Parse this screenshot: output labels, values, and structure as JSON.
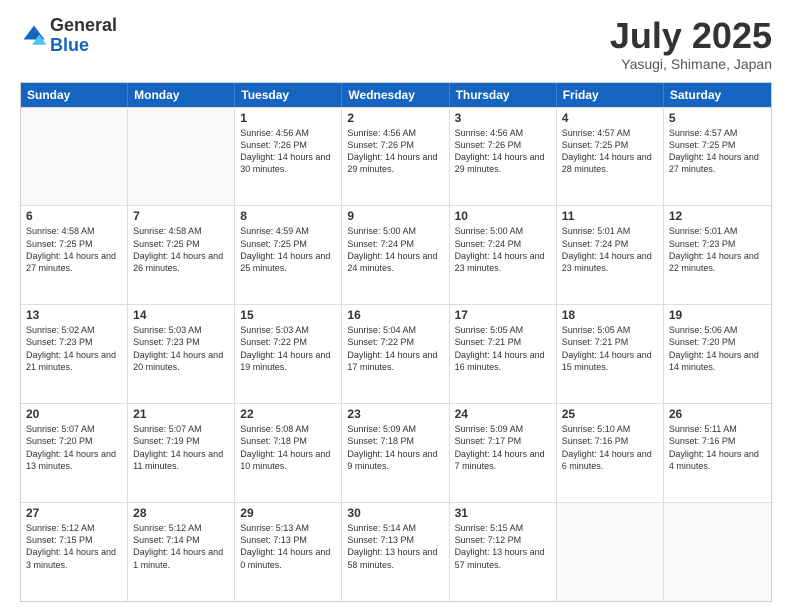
{
  "logo": {
    "general": "General",
    "blue": "Blue"
  },
  "header": {
    "month": "July 2025",
    "location": "Yasugi, Shimane, Japan"
  },
  "weekdays": [
    "Sunday",
    "Monday",
    "Tuesday",
    "Wednesday",
    "Thursday",
    "Friday",
    "Saturday"
  ],
  "rows": [
    [
      {
        "day": "",
        "empty": true
      },
      {
        "day": "",
        "empty": true
      },
      {
        "day": "1",
        "sunrise": "Sunrise: 4:56 AM",
        "sunset": "Sunset: 7:26 PM",
        "daylight": "Daylight: 14 hours and 30 minutes."
      },
      {
        "day": "2",
        "sunrise": "Sunrise: 4:56 AM",
        "sunset": "Sunset: 7:26 PM",
        "daylight": "Daylight: 14 hours and 29 minutes."
      },
      {
        "day": "3",
        "sunrise": "Sunrise: 4:56 AM",
        "sunset": "Sunset: 7:26 PM",
        "daylight": "Daylight: 14 hours and 29 minutes."
      },
      {
        "day": "4",
        "sunrise": "Sunrise: 4:57 AM",
        "sunset": "Sunset: 7:25 PM",
        "daylight": "Daylight: 14 hours and 28 minutes."
      },
      {
        "day": "5",
        "sunrise": "Sunrise: 4:57 AM",
        "sunset": "Sunset: 7:25 PM",
        "daylight": "Daylight: 14 hours and 27 minutes."
      }
    ],
    [
      {
        "day": "6",
        "sunrise": "Sunrise: 4:58 AM",
        "sunset": "Sunset: 7:25 PM",
        "daylight": "Daylight: 14 hours and 27 minutes."
      },
      {
        "day": "7",
        "sunrise": "Sunrise: 4:58 AM",
        "sunset": "Sunset: 7:25 PM",
        "daylight": "Daylight: 14 hours and 26 minutes."
      },
      {
        "day": "8",
        "sunrise": "Sunrise: 4:59 AM",
        "sunset": "Sunset: 7:25 PM",
        "daylight": "Daylight: 14 hours and 25 minutes."
      },
      {
        "day": "9",
        "sunrise": "Sunrise: 5:00 AM",
        "sunset": "Sunset: 7:24 PM",
        "daylight": "Daylight: 14 hours and 24 minutes."
      },
      {
        "day": "10",
        "sunrise": "Sunrise: 5:00 AM",
        "sunset": "Sunset: 7:24 PM",
        "daylight": "Daylight: 14 hours and 23 minutes."
      },
      {
        "day": "11",
        "sunrise": "Sunrise: 5:01 AM",
        "sunset": "Sunset: 7:24 PM",
        "daylight": "Daylight: 14 hours and 23 minutes."
      },
      {
        "day": "12",
        "sunrise": "Sunrise: 5:01 AM",
        "sunset": "Sunset: 7:23 PM",
        "daylight": "Daylight: 14 hours and 22 minutes."
      }
    ],
    [
      {
        "day": "13",
        "sunrise": "Sunrise: 5:02 AM",
        "sunset": "Sunset: 7:23 PM",
        "daylight": "Daylight: 14 hours and 21 minutes."
      },
      {
        "day": "14",
        "sunrise": "Sunrise: 5:03 AM",
        "sunset": "Sunset: 7:23 PM",
        "daylight": "Daylight: 14 hours and 20 minutes."
      },
      {
        "day": "15",
        "sunrise": "Sunrise: 5:03 AM",
        "sunset": "Sunset: 7:22 PM",
        "daylight": "Daylight: 14 hours and 19 minutes."
      },
      {
        "day": "16",
        "sunrise": "Sunrise: 5:04 AM",
        "sunset": "Sunset: 7:22 PM",
        "daylight": "Daylight: 14 hours and 17 minutes."
      },
      {
        "day": "17",
        "sunrise": "Sunrise: 5:05 AM",
        "sunset": "Sunset: 7:21 PM",
        "daylight": "Daylight: 14 hours and 16 minutes."
      },
      {
        "day": "18",
        "sunrise": "Sunrise: 5:05 AM",
        "sunset": "Sunset: 7:21 PM",
        "daylight": "Daylight: 14 hours and 15 minutes."
      },
      {
        "day": "19",
        "sunrise": "Sunrise: 5:06 AM",
        "sunset": "Sunset: 7:20 PM",
        "daylight": "Daylight: 14 hours and 14 minutes."
      }
    ],
    [
      {
        "day": "20",
        "sunrise": "Sunrise: 5:07 AM",
        "sunset": "Sunset: 7:20 PM",
        "daylight": "Daylight: 14 hours and 13 minutes."
      },
      {
        "day": "21",
        "sunrise": "Sunrise: 5:07 AM",
        "sunset": "Sunset: 7:19 PM",
        "daylight": "Daylight: 14 hours and 11 minutes."
      },
      {
        "day": "22",
        "sunrise": "Sunrise: 5:08 AM",
        "sunset": "Sunset: 7:18 PM",
        "daylight": "Daylight: 14 hours and 10 minutes."
      },
      {
        "day": "23",
        "sunrise": "Sunrise: 5:09 AM",
        "sunset": "Sunset: 7:18 PM",
        "daylight": "Daylight: 14 hours and 9 minutes."
      },
      {
        "day": "24",
        "sunrise": "Sunrise: 5:09 AM",
        "sunset": "Sunset: 7:17 PM",
        "daylight": "Daylight: 14 hours and 7 minutes."
      },
      {
        "day": "25",
        "sunrise": "Sunrise: 5:10 AM",
        "sunset": "Sunset: 7:16 PM",
        "daylight": "Daylight: 14 hours and 6 minutes."
      },
      {
        "day": "26",
        "sunrise": "Sunrise: 5:11 AM",
        "sunset": "Sunset: 7:16 PM",
        "daylight": "Daylight: 14 hours and 4 minutes."
      }
    ],
    [
      {
        "day": "27",
        "sunrise": "Sunrise: 5:12 AM",
        "sunset": "Sunset: 7:15 PM",
        "daylight": "Daylight: 14 hours and 3 minutes."
      },
      {
        "day": "28",
        "sunrise": "Sunrise: 5:12 AM",
        "sunset": "Sunset: 7:14 PM",
        "daylight": "Daylight: 14 hours and 1 minute."
      },
      {
        "day": "29",
        "sunrise": "Sunrise: 5:13 AM",
        "sunset": "Sunset: 7:13 PM",
        "daylight": "Daylight: 14 hours and 0 minutes."
      },
      {
        "day": "30",
        "sunrise": "Sunrise: 5:14 AM",
        "sunset": "Sunset: 7:13 PM",
        "daylight": "Daylight: 13 hours and 58 minutes."
      },
      {
        "day": "31",
        "sunrise": "Sunrise: 5:15 AM",
        "sunset": "Sunset: 7:12 PM",
        "daylight": "Daylight: 13 hours and 57 minutes."
      },
      {
        "day": "",
        "empty": true
      },
      {
        "day": "",
        "empty": true
      }
    ]
  ]
}
